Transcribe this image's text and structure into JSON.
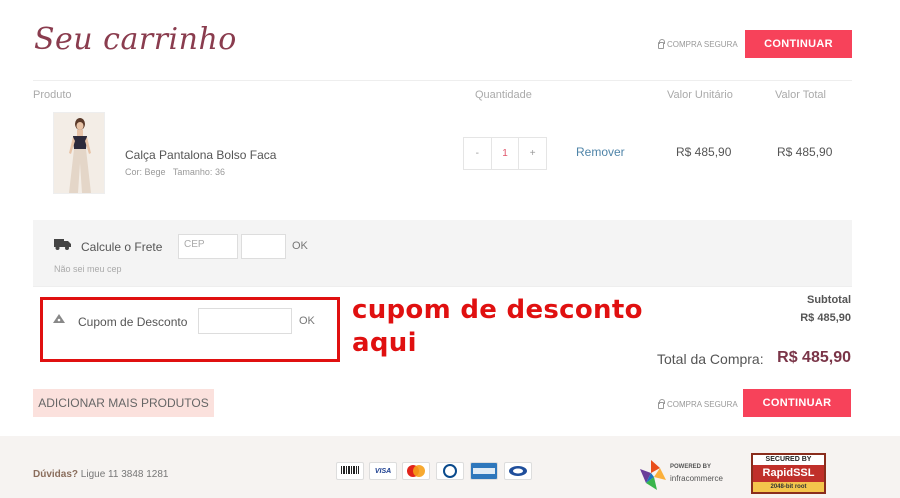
{
  "header": {
    "title": "Seu carrinho",
    "secure_text": "COMPRA SEGURA",
    "continue_label": "CONTINUAR"
  },
  "table": {
    "headers": [
      "Produto",
      "Quantidade",
      "Valor Unitário",
      "Valor Total"
    ]
  },
  "item": {
    "name": "Calça Pantalona Bolso Faca",
    "color_label": "Cor:",
    "color": "Bege",
    "size_label": "Tamanho:",
    "size": "36",
    "qty_minus": "-",
    "qty": "1",
    "qty_plus": "+",
    "remove_label": "Remover",
    "unit_price": "R$ 485,90",
    "total_price": "R$ 485,90"
  },
  "shipping": {
    "label": "Calcule o Frete",
    "cep_placeholder": "CEP",
    "ok_label": "OK",
    "unknown_cep": "Não sei meu cep"
  },
  "coupon": {
    "label": "Cupom de Desconto",
    "ok_label": "OK",
    "annotation_line1": "cupom de desconto",
    "annotation_line2": "aqui",
    "annotation_color": "#e01010"
  },
  "summary": {
    "subtotal_label": "Subtotal",
    "subtotal_value": "R$ 485,90",
    "total_label": "Total da Compra:",
    "total_value": "R$ 485,90"
  },
  "actions": {
    "add_more_label": "ADICIONAR MAIS PRODUTOS",
    "secure_text": "COMPRA SEGURA",
    "continue_label": "CONTINUAR"
  },
  "footer": {
    "help_label": "Dúvidas?",
    "help_text": "Ligue 11 3848 1281",
    "payment_icons": [
      "boleto",
      "visa",
      "mastercard",
      "diners",
      "amex",
      "hipercard"
    ],
    "powered_by": "POWERED BY",
    "powered_brand": "infracommerce",
    "ssl_line1": "SECURED BY",
    "ssl_line2": "RapidSSL",
    "ssl_line3": "2048-bit root"
  },
  "colors": {
    "accent": "#f7425a",
    "title": "#8a3c4e",
    "link": "#4f84a8"
  }
}
